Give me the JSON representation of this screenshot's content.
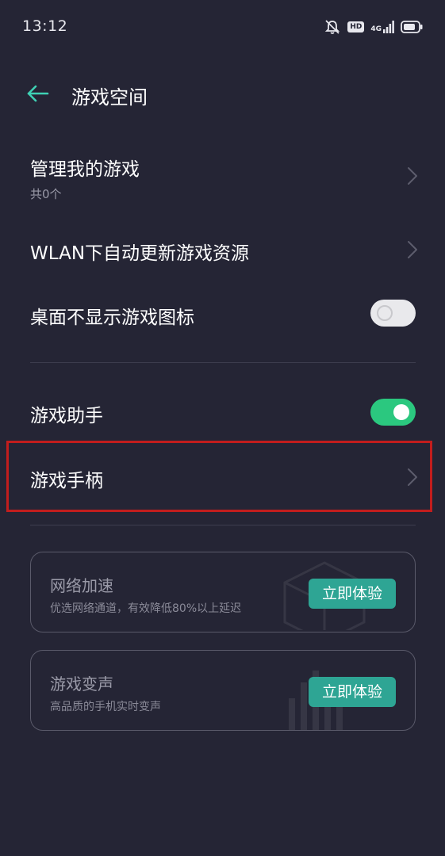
{
  "status_bar": {
    "time": "13:12",
    "hd": "HD",
    "network": "4G"
  },
  "header": {
    "title": "游戏空间"
  },
  "settings": {
    "manage_games": {
      "title": "管理我的游戏",
      "subtitle": "共0个"
    },
    "wlan_update": {
      "title": "WLAN下自动更新游戏资源"
    },
    "hide_icon": {
      "title": "桌面不显示游戏图标",
      "enabled": false
    },
    "game_assistant": {
      "title": "游戏助手",
      "enabled": true
    },
    "gamepad": {
      "title": "游戏手柄"
    }
  },
  "cards": [
    {
      "title": "网络加速",
      "description": "优选网络通道，有效降低80%以上延迟",
      "button": "立即体验"
    },
    {
      "title": "游戏变声",
      "description": "高品质的手机实时变声",
      "button": "立即体验"
    }
  ],
  "colors": {
    "background": "#252535",
    "accent": "#2ea594",
    "toggle_on": "#2bc87f",
    "highlight": "#c21d1d"
  }
}
